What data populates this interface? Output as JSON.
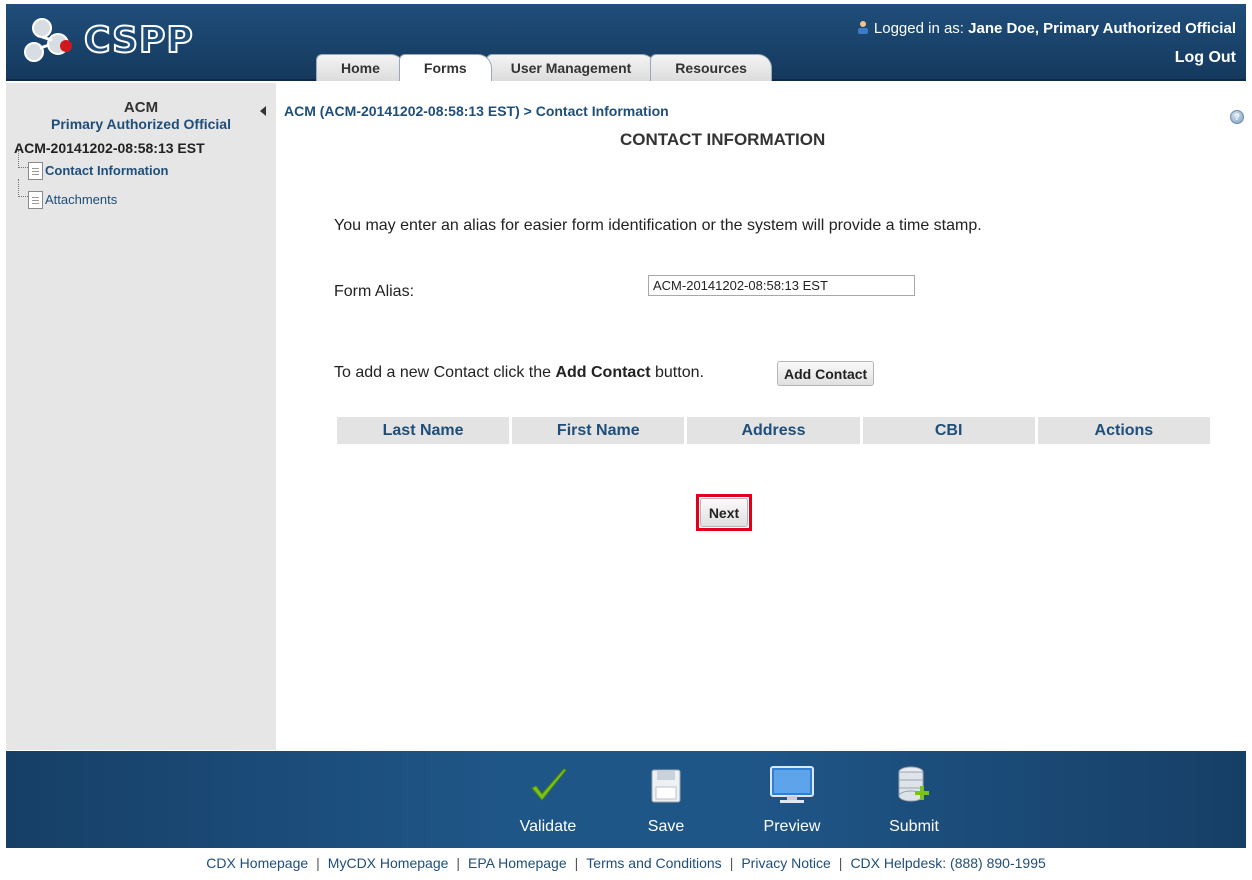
{
  "header": {
    "logo_text": "CSPP",
    "logged_in_prefix": "Logged in as: ",
    "user": "Jane Doe, Primary Authorized Official",
    "logout": "Log Out",
    "tabs": [
      {
        "label": "Home",
        "active": false
      },
      {
        "label": "Forms",
        "active": true
      },
      {
        "label": "User Management",
        "active": false
      },
      {
        "label": "Resources",
        "active": false
      }
    ]
  },
  "sidebar": {
    "title": "ACM",
    "role": "Primary Authorized Official",
    "form_id": "ACM-20141202-08:58:13 EST",
    "items": [
      {
        "label": "Contact Information",
        "active": true
      },
      {
        "label": "Attachments",
        "active": false
      }
    ]
  },
  "main": {
    "breadcrumb": "ACM (ACM-20141202-08:58:13 EST) > Contact Information",
    "title": "CONTACT INFORMATION",
    "intro": "You may enter an alias for easier form identification or the system will provide a time stamp.",
    "alias_label": "Form Alias:",
    "alias_value": "ACM-20141202-08:58:13 EST",
    "add_text_before": "To add a new Contact click the ",
    "add_text_bold": "Add Contact",
    "add_text_after": " button.",
    "add_button": "Add Contact",
    "table_headers": [
      "Last Name",
      "First Name",
      "Address",
      "CBI",
      "Actions"
    ],
    "next_button": "Next"
  },
  "footer": {
    "buttons": [
      "Validate",
      "Save",
      "Preview",
      "Submit"
    ],
    "links": [
      "CDX Homepage",
      "MyCDX Homepage",
      "EPA Homepage",
      "Terms and Conditions",
      "Privacy Notice",
      "CDX Helpdesk: (888) 890-1995"
    ]
  },
  "colors": {
    "brand_blue": "#1f4e7a",
    "highlight_red": "#e0001a",
    "validate_green": "#7bc21c"
  }
}
